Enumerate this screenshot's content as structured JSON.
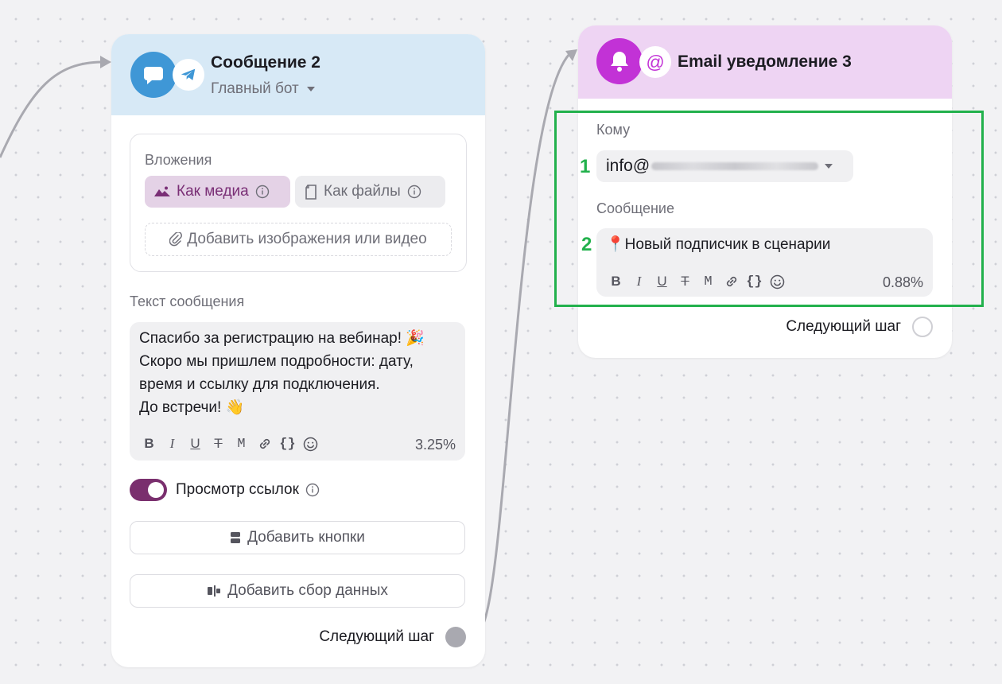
{
  "card1": {
    "title": "Сообщение 2",
    "subtitle": "Главный бот",
    "attachments": {
      "label": "Вложения",
      "as_media": "Как медиа",
      "as_files": "Как файлы",
      "add_media": "Добавить изображения или видео"
    },
    "message": {
      "label": "Текст сообщения",
      "lines": [
        "Спасибо за регистрацию на вебинар! 🎉",
        "Скоро мы пришлем подробности: дату,",
        "время и ссылку для подключения.",
        "До встречи! 👋"
      ],
      "percent": "3.25%"
    },
    "link_preview": "Просмотр ссылок",
    "add_buttons": "Добавить кнопки",
    "add_data_collection": "Добавить сбор данных",
    "next_step": "Следующий шаг"
  },
  "card2": {
    "title": "Email уведомление 3",
    "to_label": "Кому",
    "to_value": "info@",
    "message_label": "Сообщение",
    "message_text": "📍Новый подписчик в сценарии",
    "percent": "0.88%",
    "next_step": "Следующий шаг"
  },
  "toolbar": {
    "bold": "B",
    "italic": "I",
    "underline": "U",
    "strike": "T",
    "mono": "M",
    "variables": "{}"
  },
  "annotations": {
    "n1": "1",
    "n2": "2"
  },
  "icons": [
    "chat-bubble-icon",
    "telegram-icon",
    "chevron-down-icon",
    "mountain-image-icon",
    "info-icon",
    "file-icon",
    "paperclip-icon",
    "link-icon",
    "emoji-icon",
    "buttons-icon",
    "data-collection-icon",
    "bell-icon",
    "at-sign-icon"
  ],
  "colors": {
    "telegram_blue": "#3f97d6",
    "purple_accent": "#c232d6",
    "media_chip_text": "#7a2f76",
    "toggle_on": "#7a2f6e",
    "highlight_green": "#22b14c"
  }
}
